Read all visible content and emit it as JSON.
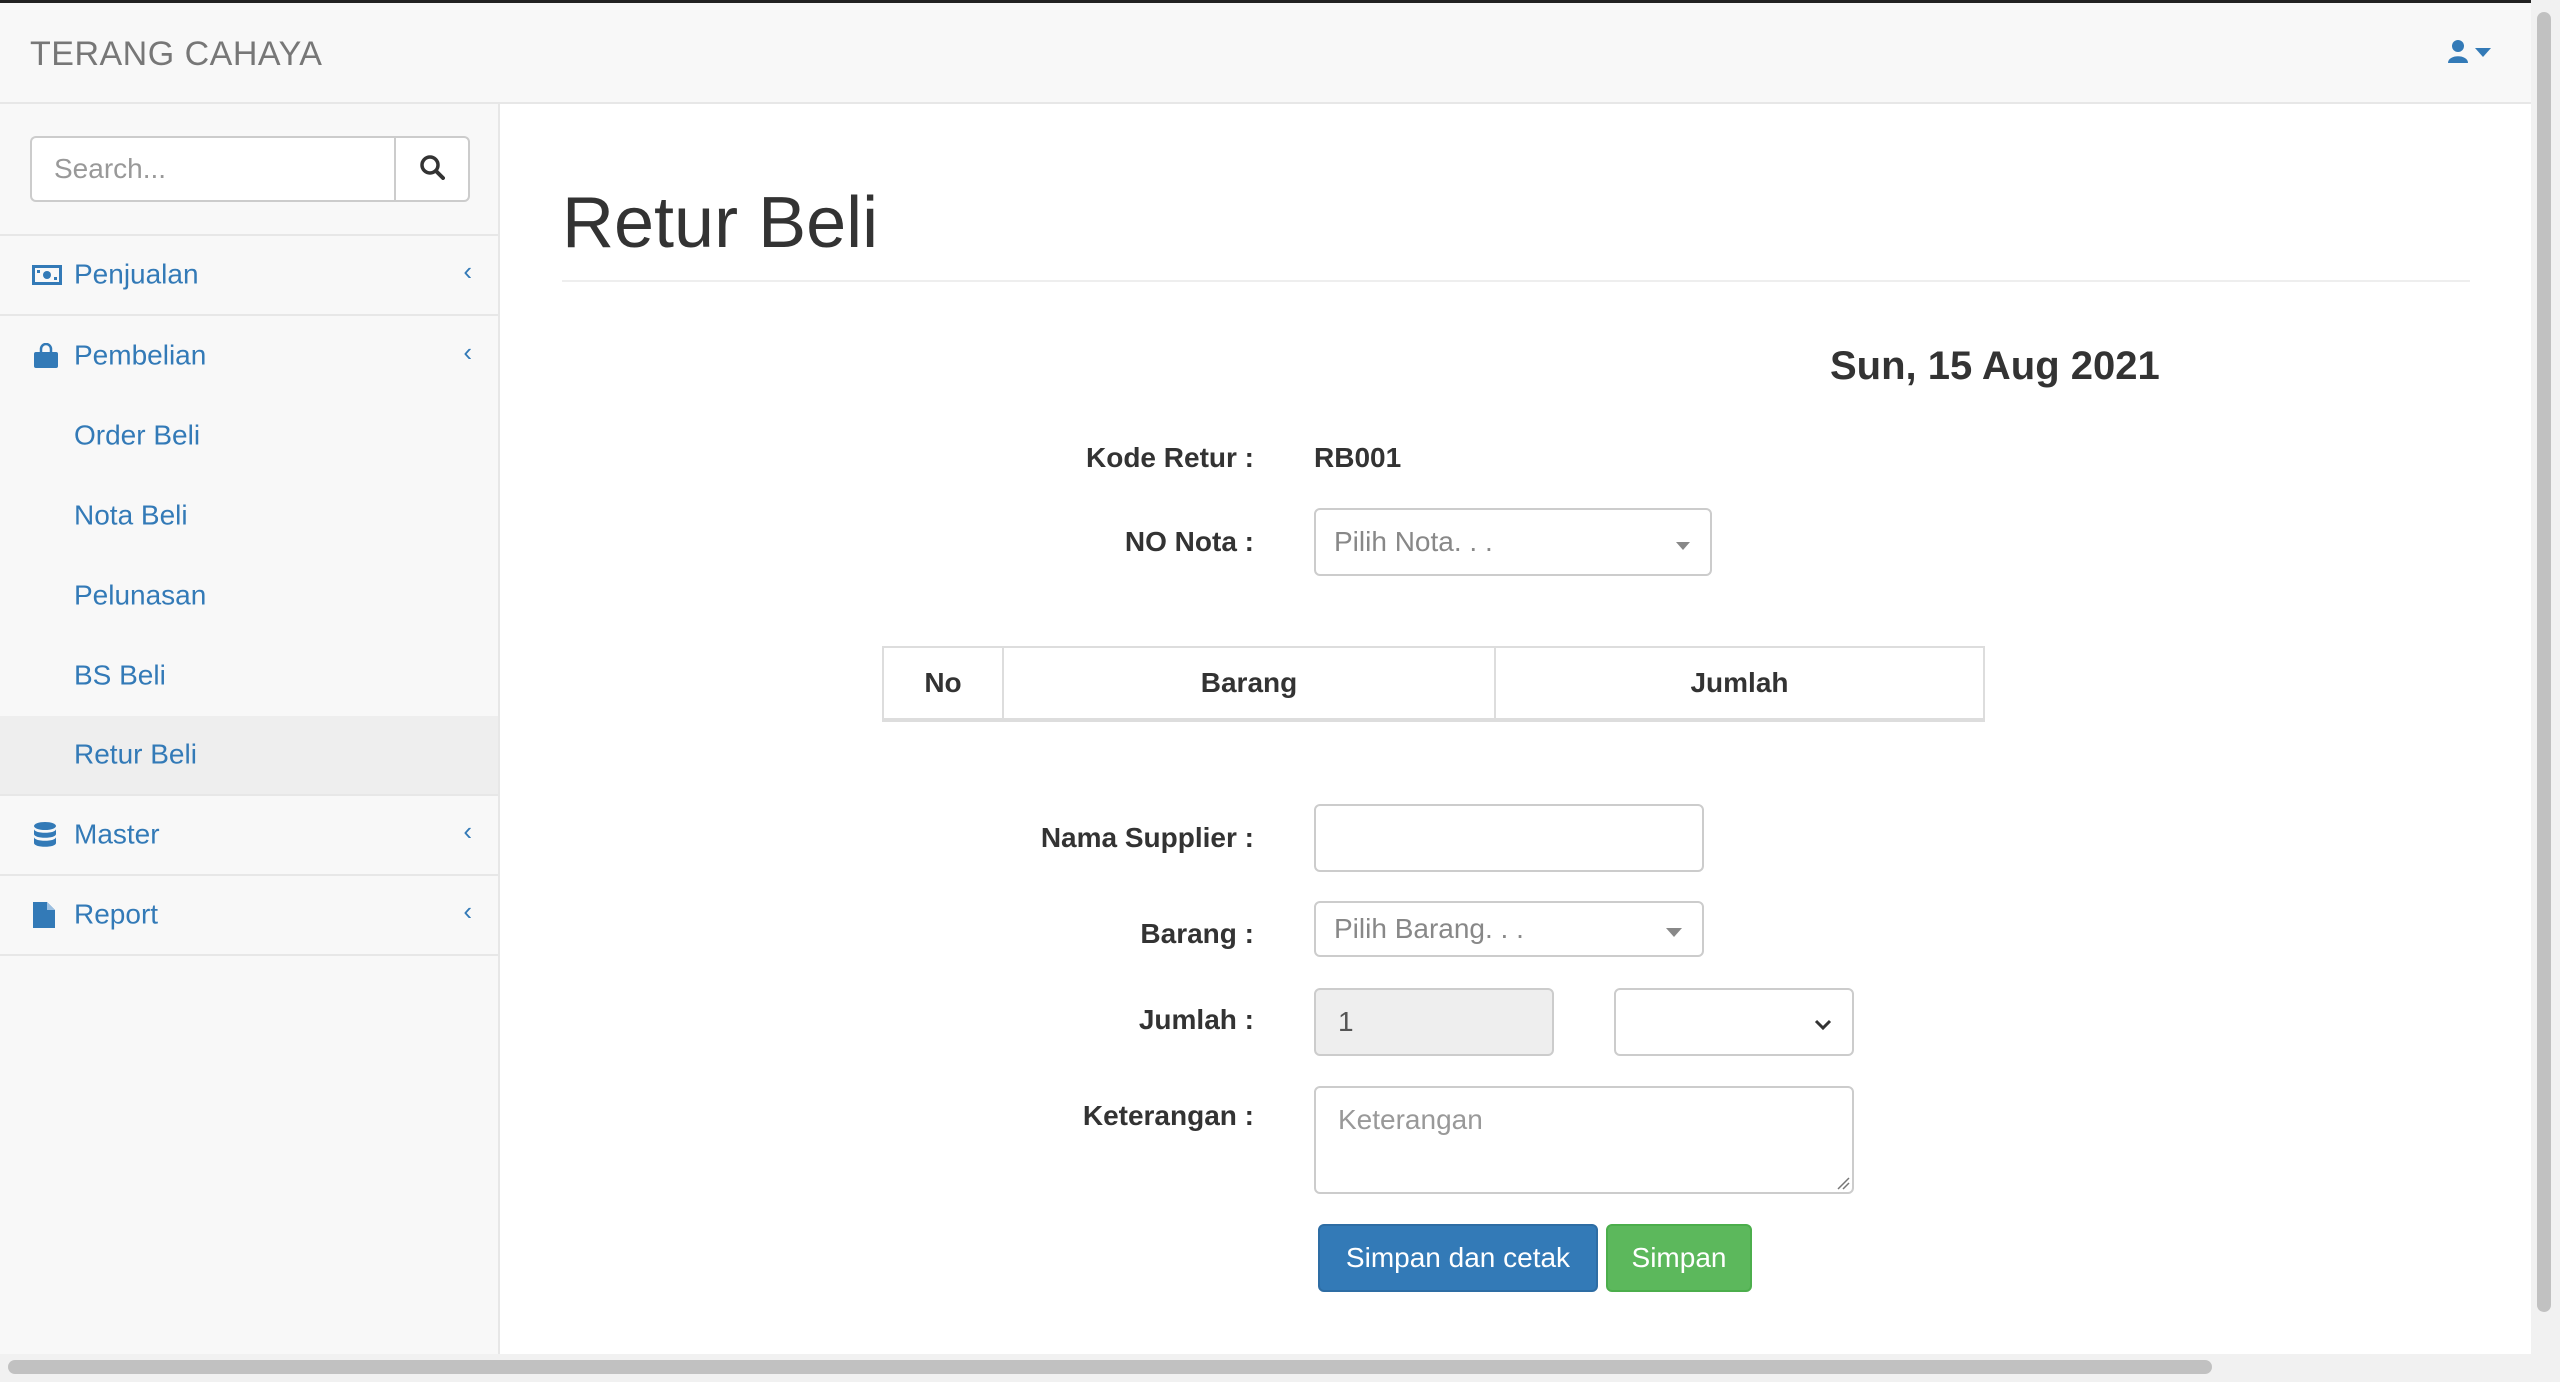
{
  "app": {
    "brand": "TERANG CAHAYA"
  },
  "header": {
    "user_icon": "user-icon"
  },
  "sidebar": {
    "search_placeholder": "Search...",
    "items": [
      {
        "label": "Penjualan",
        "icon": "money-icon"
      },
      {
        "label": "Pembelian",
        "icon": "shopping-bag-icon"
      },
      {
        "label": "Master",
        "icon": "database-icon"
      },
      {
        "label": "Report",
        "icon": "file-icon"
      }
    ],
    "pembelian_sub": [
      {
        "label": "Order Beli"
      },
      {
        "label": "Nota Beli"
      },
      {
        "label": "Pelunasan"
      },
      {
        "label": "BS Beli"
      },
      {
        "label": "Retur Beli",
        "active": true
      }
    ]
  },
  "page": {
    "title": "Retur Beli",
    "date": "Sun, 15 Aug 2021"
  },
  "form": {
    "kode_retur_label": "Kode Retur :",
    "kode_retur_value": "RB001",
    "no_nota_label": "NO Nota :",
    "no_nota_placeholder": "Pilih Nota. . .",
    "nama_supplier_label": "Nama Supplier :",
    "nama_supplier_value": "",
    "barang_label": "Barang :",
    "barang_placeholder": "Pilih Barang. . .",
    "jumlah_label": "Jumlah :",
    "jumlah_value": "1",
    "unit_value": "",
    "keterangan_label": "Keterangan :",
    "keterangan_placeholder": "Keterangan"
  },
  "table": {
    "columns": [
      "No",
      "Barang",
      "Jumlah"
    ],
    "rows": []
  },
  "buttons": {
    "save_print": "Simpan dan cetak",
    "save": "Simpan"
  },
  "colors": {
    "link": "#337ab7",
    "primary": "#337ab7",
    "success": "#5cb85c"
  }
}
